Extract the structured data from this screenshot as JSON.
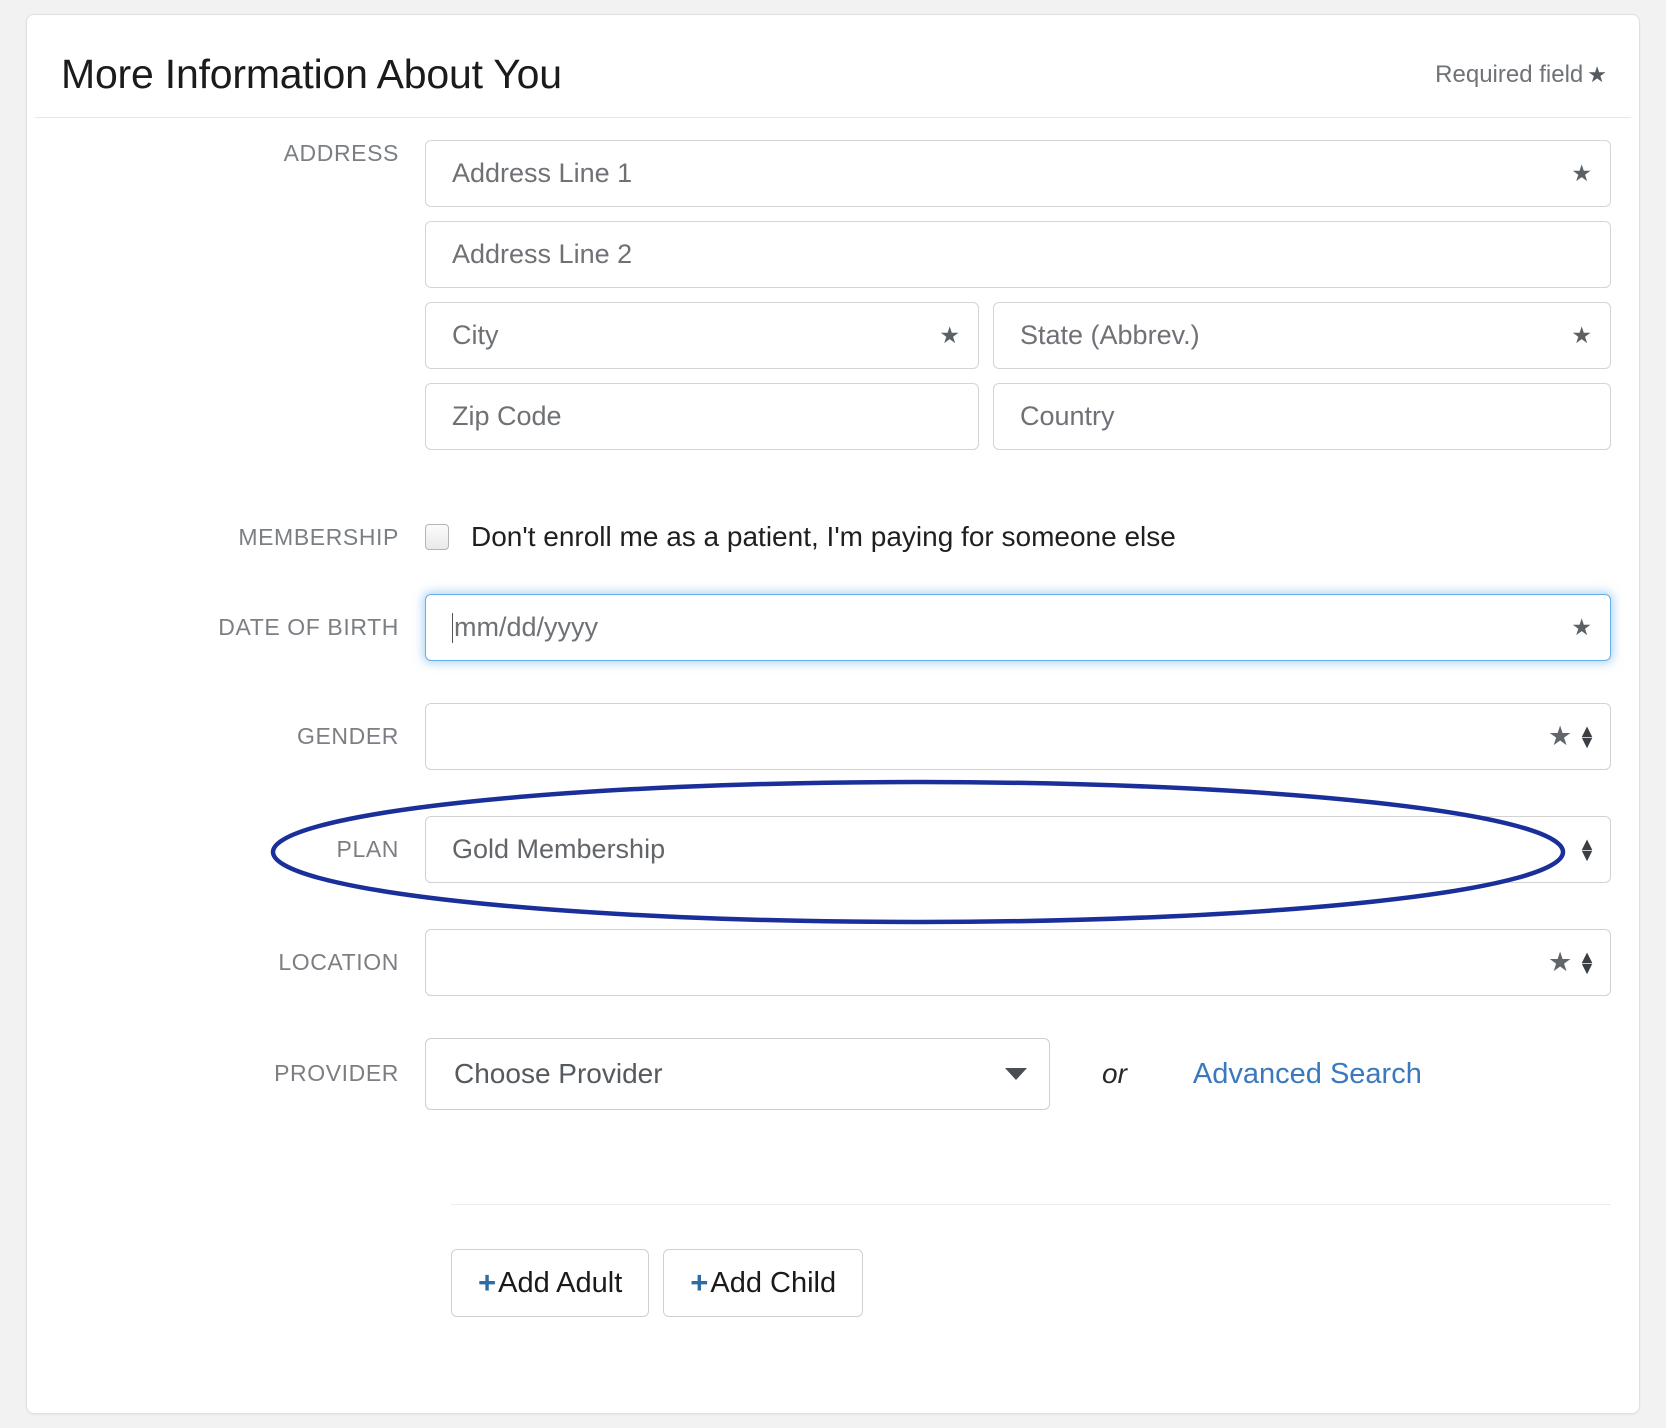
{
  "header": {
    "title": "More Information About You",
    "required_note": "Required field",
    "required_star": "★"
  },
  "form": {
    "address": {
      "label": "ADDRESS",
      "line1_placeholder": "Address Line 1",
      "line1_required": "★",
      "line2_placeholder": "Address Line 2",
      "city_placeholder": "City",
      "city_required": "★",
      "state_placeholder": "State (Abbrev.)",
      "state_required": "★",
      "zip_placeholder": "Zip Code",
      "country_placeholder": "Country"
    },
    "membership": {
      "label": "MEMBERSHIP",
      "checkbox_text": "Don't enroll me as a patient, I'm paying for someone else",
      "checked": false
    },
    "date_of_birth": {
      "label": "DATE OF BIRTH",
      "placeholder": "mm/dd/yyyy",
      "value": "",
      "required": "★",
      "focused": true
    },
    "gender": {
      "label": "GENDER",
      "value": "",
      "required": "★"
    },
    "plan": {
      "label": "PLAN",
      "value": "Gold Membership"
    },
    "location": {
      "label": "LOCATION",
      "value": "",
      "required": "★"
    },
    "provider": {
      "label": "PROVIDER",
      "value": "Choose Provider",
      "or_text": "or",
      "advanced_search": "Advanced Search"
    }
  },
  "actions": {
    "add_adult": "Add Adult",
    "add_child": "Add Child",
    "plus": "+"
  },
  "icons": {
    "spinner_up": "▲",
    "spinner_down": "▼"
  },
  "colors": {
    "link": "#3a79bd",
    "focus_border": "#66afe9",
    "annotation": "#1a2f99",
    "label": "#7b7f84"
  }
}
